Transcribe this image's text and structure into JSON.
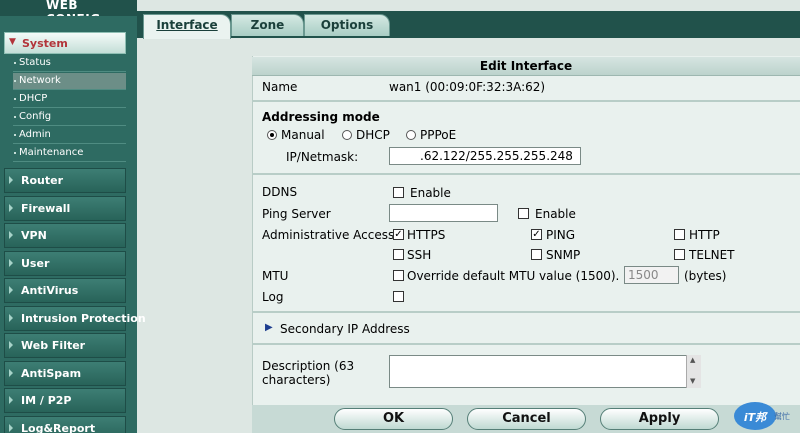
{
  "brand": {
    "title": "WEB CONFIG"
  },
  "sidebar": {
    "system": {
      "label": "System"
    },
    "system_items": [
      "Status",
      "Network",
      "DHCP",
      "Config",
      "Admin",
      "Maintenance"
    ],
    "menu": [
      "Router",
      "Firewall",
      "VPN",
      "User",
      "AntiVirus",
      "Intrusion Protection",
      "Web Filter",
      "AntiSpam",
      "IM / P2P",
      "Log&Report"
    ]
  },
  "tabs": [
    "Interface",
    "Zone",
    "Options"
  ],
  "form": {
    "title": "Edit Interface",
    "name_label": "Name",
    "name_value": "wan1 (00:09:0F:32:3A:62)",
    "addressing_label": "Addressing mode",
    "mode_manual": "Manual",
    "mode_dhcp": "DHCP",
    "mode_pppoe": "PPPoE",
    "ip_label": "IP/Netmask:",
    "ip_value": ".62.122/255.255.255.248",
    "ddns_label": "DDNS",
    "enable_label": "Enable",
    "ping_server_label": "Ping Server",
    "admin_access_label": "Administrative Access",
    "access": {
      "https": "HTTPS",
      "ping": "PING",
      "http": "HTTP",
      "ssh": "SSH",
      "snmp": "SNMP",
      "telnet": "TELNET"
    },
    "mtu_label": "MTU",
    "mtu_override_label": "Override default MTU value (1500).",
    "mtu_value": "1500",
    "mtu_unit": "(bytes)",
    "log_label": "Log",
    "secondary_ip_label": "Secondary IP Address",
    "description_label": "Description (63 characters)"
  },
  "buttons": {
    "ok": "OK",
    "cancel": "Cancel",
    "apply": "Apply"
  },
  "watermark": {
    "logo": "iT邦",
    "side": "幫忙"
  },
  "colors": {
    "accent": "#b2343a",
    "sidebar": "#2e6b62",
    "header": "#21524b",
    "panel": "#e9f1ee"
  }
}
